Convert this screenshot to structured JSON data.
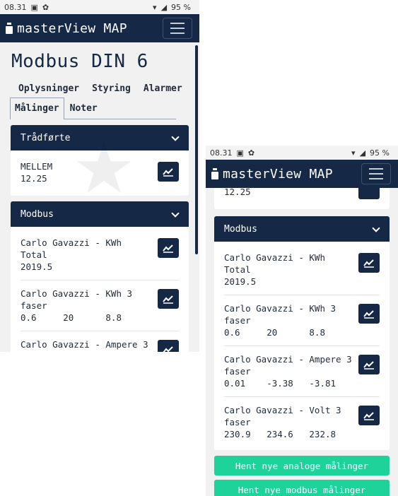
{
  "status": {
    "time": "08.31",
    "battery": "95 %"
  },
  "app": {
    "brand": "masterView MAP"
  },
  "page": {
    "title": "Modbus DIN 6"
  },
  "tabs": [
    {
      "label": "Oplysninger"
    },
    {
      "label": "Styring"
    },
    {
      "label": "Alarmer"
    },
    {
      "label": "Målinger"
    },
    {
      "label": "Noter"
    }
  ],
  "wired": {
    "title": "Trådførte",
    "items": [
      {
        "name": "MELLEM",
        "value": "12.25"
      }
    ]
  },
  "modbus": {
    "title": "Modbus",
    "items": [
      {
        "name1": "Carlo Gavazzi - KWh",
        "name2": "Total",
        "value": "2019.5"
      },
      {
        "name1": "Carlo Gavazzi - KWh 3",
        "name2": "faser",
        "value": "0.6     20      8.8"
      },
      {
        "name1": "Carlo Gavazzi - Ampere 3",
        "name2": "faser",
        "value": "0.01    -3.38   -3.81"
      },
      {
        "name1": "Carlo Gavazzi - Volt 3",
        "name2": "faser",
        "value": "230.9   234.6   232.8"
      }
    ],
    "right_items": [
      {
        "name1": "Carlo Gavazzi - KWh",
        "name2": "Total",
        "value": "2019.5"
      },
      {
        "name1": "Carlo Gavazzi - KWh 3",
        "name2": "faser",
        "value": "0.6     20      8.8"
      },
      {
        "name1": "Carlo Gavazzi - Ampere 3",
        "name2": "faser",
        "value": "0.01    -3.38   -3.81"
      },
      {
        "name1": "Carlo Gavazzi - Volt 3",
        "name2": "faser",
        "value": "230.9   234.6   232.8"
      }
    ],
    "partial_label": "Carlo Gavazzi - Ampere 3",
    "partial_label2": "faser"
  },
  "actions": {
    "analog": "Hent nye analoge målinger",
    "modbus": "Hent nye modbus målinger"
  },
  "colors": {
    "navy": "#152845",
    "green": "#1dd39a"
  }
}
